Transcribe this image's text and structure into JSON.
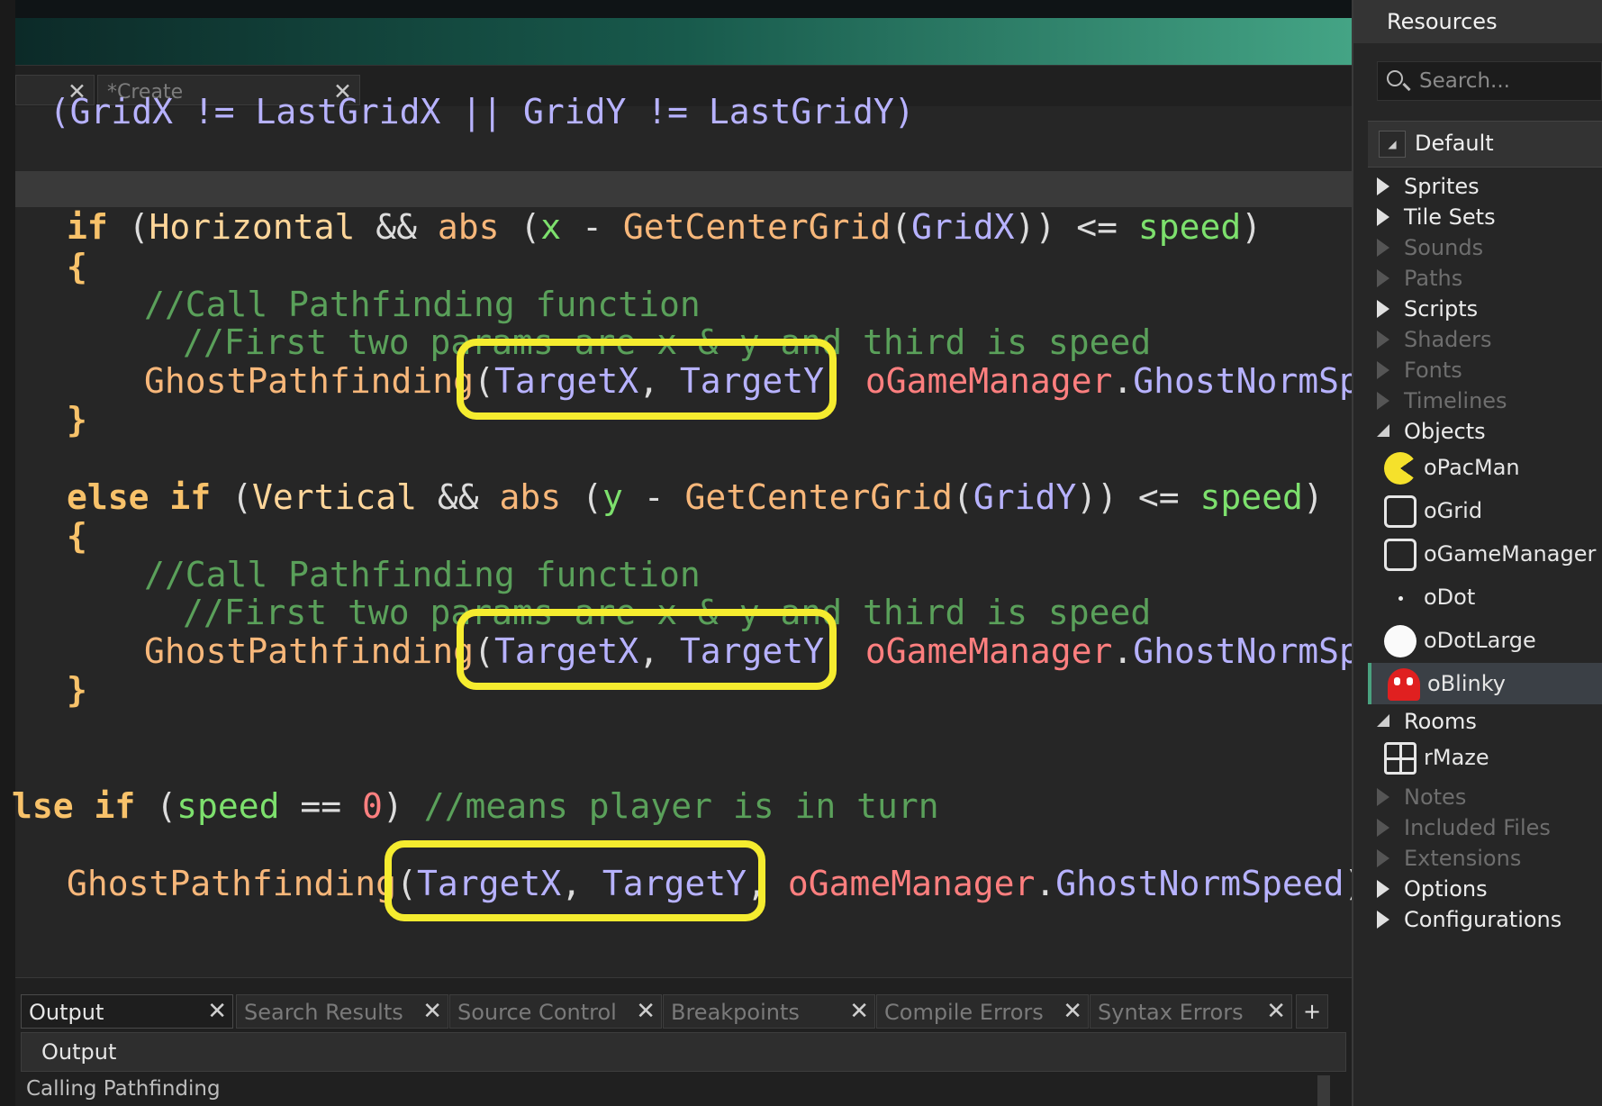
{
  "code_tabs": [
    {
      "label": ""
    },
    {
      "label": "*Create"
    }
  ],
  "code": {
    "partial_top": "  (GridX != LastGridX || GridY != LastGridY)",
    "if_kw": "if",
    "if_open": "(",
    "horizontal": "Horizontal",
    "and": "&&",
    "abs": "abs",
    "paren_open": "(",
    "x": "x",
    "minus": "-",
    "get_center": "GetCenterGrid",
    "gridx": "GridX",
    "le": "<=",
    "speed": "speed",
    "brace_open": "{",
    "brace_close": "}",
    "comment1": "//Call Pathfinding function",
    "comment2": "//First two params are x & y and third is speed",
    "ghost_pf": "GhostPathfinding",
    "targetx": "TargetX",
    "targety": "TargetY",
    "comma": ",",
    "ogm": "oGameManager",
    "dot": ".",
    "ghost_norm_trunc": "GhostNormSpee",
    "else_kw": "else",
    "vertical": "Vertical",
    "y": "y",
    "gridy": "GridY",
    "lse_kw": "lse",
    "eqeq": "==",
    "zero": "0",
    "comment3": "//means player is in turn",
    "ghost_norm_full": "GhostNormSpeed",
    "close_semi": ");"
  },
  "bottom_tabs": [
    {
      "label": "Output",
      "active": true
    },
    {
      "label": "Search Results"
    },
    {
      "label": "Source Control"
    },
    {
      "label": "Breakpoints"
    },
    {
      "label": "Compile Errors"
    },
    {
      "label": "Syntax Errors"
    }
  ],
  "bottom_plus": "+",
  "output": {
    "header": "Output",
    "text": "Calling Pathfinding"
  },
  "resources": {
    "title": "Resources",
    "search_placeholder": "Search...",
    "group": "Default",
    "items": [
      {
        "label": "Sprites",
        "dimmed": false
      },
      {
        "label": "Tile Sets",
        "dimmed": false
      },
      {
        "label": "Sounds",
        "dimmed": true
      },
      {
        "label": "Paths",
        "dimmed": true
      },
      {
        "label": "Scripts",
        "dimmed": false
      },
      {
        "label": "Shaders",
        "dimmed": true
      },
      {
        "label": "Fonts",
        "dimmed": true
      },
      {
        "label": "Timelines",
        "dimmed": true
      },
      {
        "label": "Objects",
        "dimmed": false
      }
    ],
    "objects": [
      {
        "label": "oPacMan",
        "icon": "pacman-icon"
      },
      {
        "label": "oGrid",
        "icon": "object-icon"
      },
      {
        "label": "oGameManager",
        "icon": "object-icon"
      },
      {
        "label": "oDot",
        "icon": "dot-icon"
      },
      {
        "label": "oDotLarge",
        "icon": "large-dot-icon"
      },
      {
        "label": "oBlinky",
        "icon": "ghost-icon",
        "selected": true
      }
    ],
    "rooms_label": "Rooms",
    "rooms": [
      {
        "label": "rMaze",
        "icon": "room-icon"
      }
    ],
    "more": [
      {
        "label": "Notes",
        "dimmed": true
      },
      {
        "label": "Included Files",
        "dimmed": true
      },
      {
        "label": "Extensions",
        "dimmed": true
      },
      {
        "label": "Options",
        "dimmed": false
      },
      {
        "label": "Configurations",
        "dimmed": false
      }
    ]
  },
  "colors": {
    "highlight_ring": "#f5ec2f",
    "selected_accent": "#4aa27f",
    "header_gradient_end": "#44a485"
  }
}
